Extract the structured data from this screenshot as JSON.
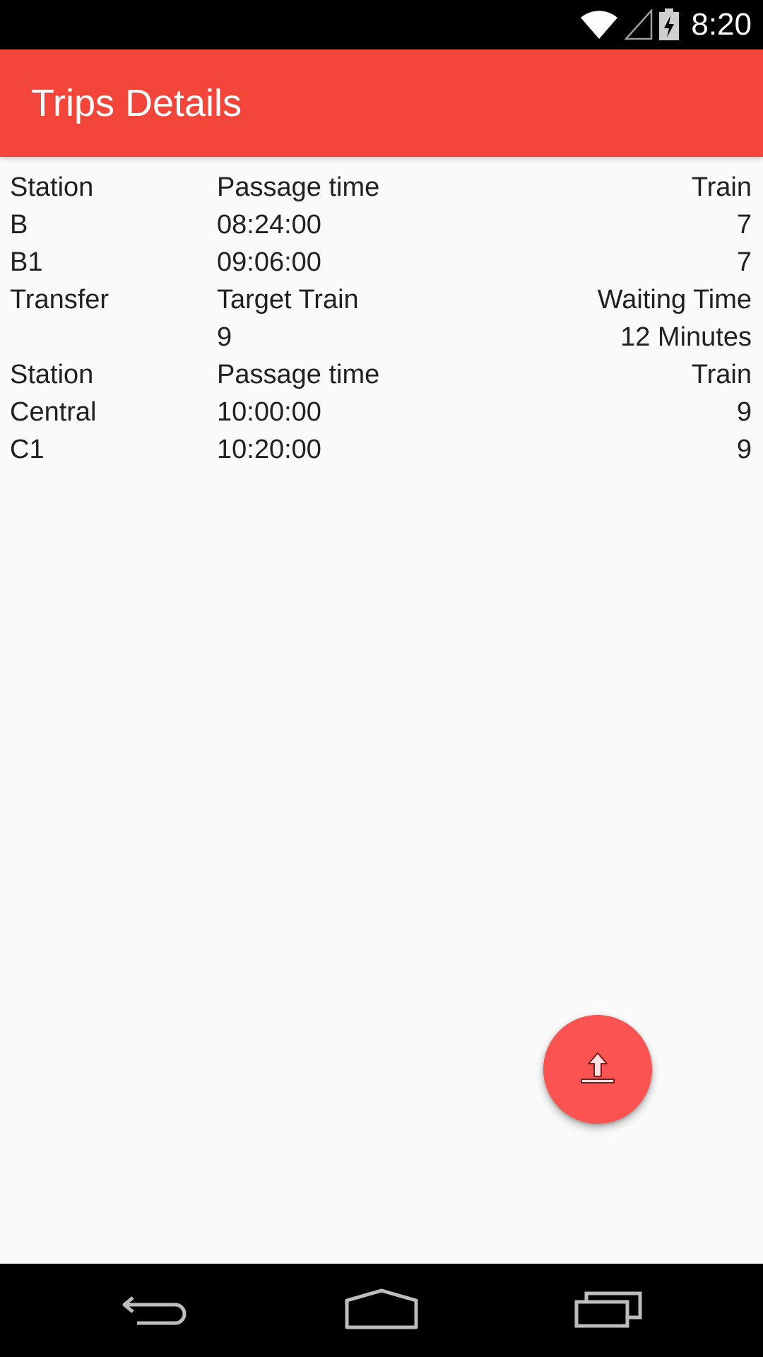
{
  "status_bar": {
    "time": "8:20",
    "icons": [
      "wifi-icon",
      "signal-icon",
      "battery-charging-icon"
    ]
  },
  "app_bar": {
    "title": "Trips Details",
    "color": "#f4453b"
  },
  "trip": {
    "rows": [
      {
        "station": "Station",
        "time": "Passage time",
        "train": "Train"
      },
      {
        "station": "B",
        "time": "08:24:00",
        "train": "7"
      },
      {
        "station": "B1",
        "time": "09:06:00",
        "train": "7"
      },
      {
        "station": "Transfer",
        "time": "Target Train",
        "train": "Waiting Time"
      },
      {
        "station": "",
        "time": "9",
        "train": "12 Minutes"
      },
      {
        "station": "Station",
        "time": "Passage time",
        "train": "Train"
      },
      {
        "station": "Central",
        "time": "10:00:00",
        "train": "9"
      },
      {
        "station": "C1",
        "time": "10:20:00",
        "train": "9"
      }
    ]
  },
  "fab": {
    "icon": "upload-icon",
    "color": "#fb5252"
  },
  "nav_bar": {
    "icons": [
      "back-icon",
      "home-icon",
      "recents-icon"
    ]
  }
}
